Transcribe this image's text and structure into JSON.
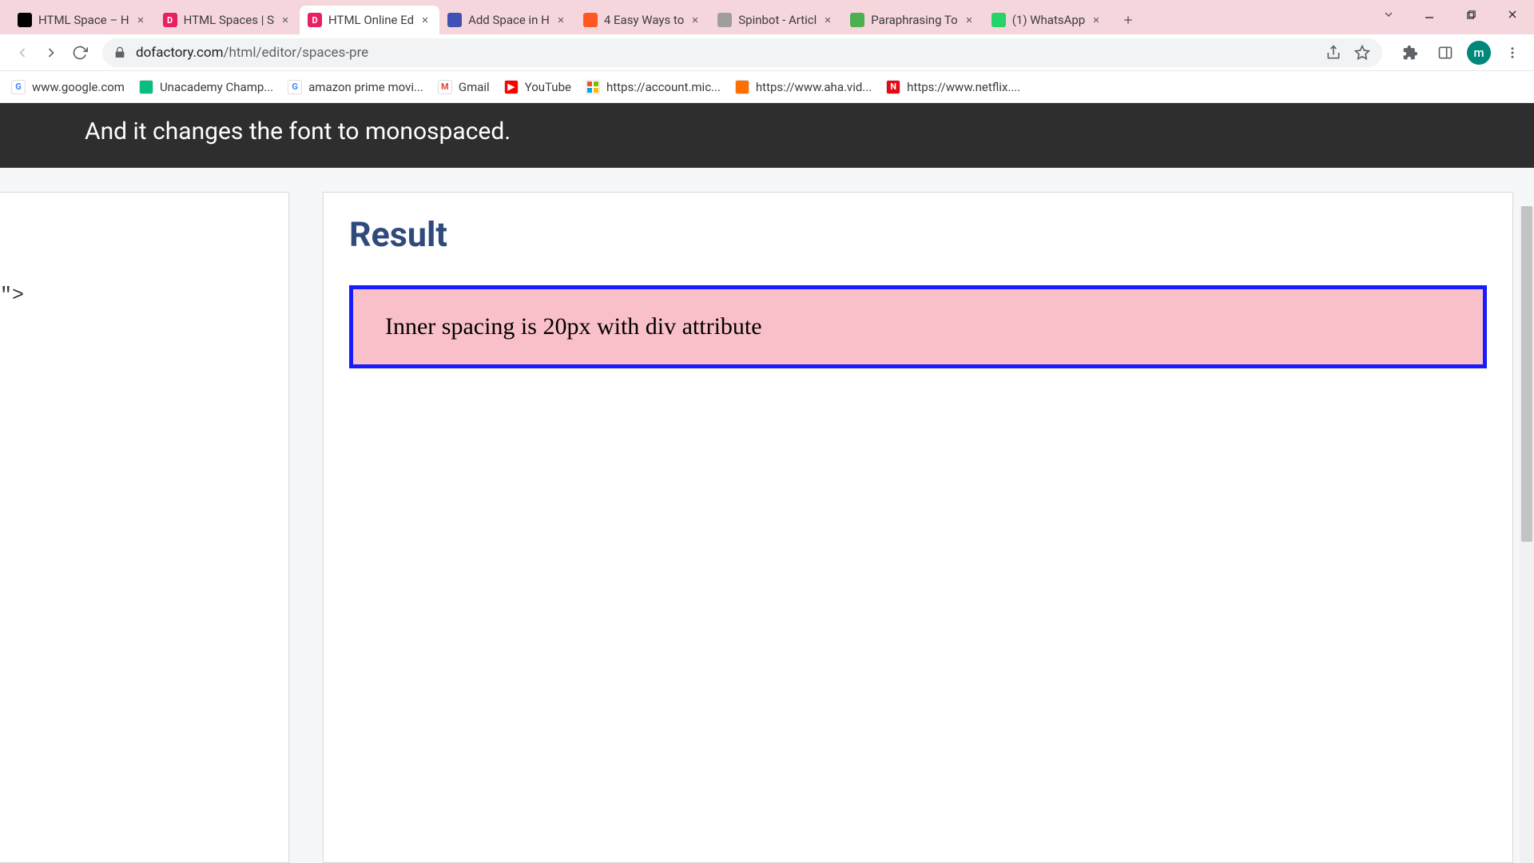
{
  "tabs": [
    {
      "title": "HTML Space – H",
      "favicon_bg": "#000",
      "favicon_letter": ""
    },
    {
      "title": "HTML Spaces | S",
      "favicon_bg": "#e91e63",
      "favicon_letter": "D"
    },
    {
      "title": "HTML Online Ed",
      "favicon_bg": "#e91e63",
      "favicon_letter": "D",
      "active": true
    },
    {
      "title": "Add Space in H",
      "favicon_bg": "#3f51b5",
      "favicon_letter": ""
    },
    {
      "title": "4 Easy Ways to",
      "favicon_bg": "#ff5722",
      "favicon_letter": ""
    },
    {
      "title": "Spinbot - Articl",
      "favicon_bg": "#9e9e9e",
      "favicon_letter": ""
    },
    {
      "title": "Paraphrasing To",
      "favicon_bg": "#4caf50",
      "favicon_letter": ""
    },
    {
      "title": "(1) WhatsApp",
      "favicon_bg": "#25d366",
      "favicon_letter": ""
    }
  ],
  "address": {
    "domain": "dofactory.com",
    "path": "/html/editor/spaces-pre"
  },
  "avatar_letter": "m",
  "bookmarks": [
    {
      "label": "www.google.com",
      "favicon_bg": "#fff",
      "letter": "G",
      "letter_color": "#4285f4"
    },
    {
      "label": "Unacademy Champ...",
      "favicon_bg": "#08bd80",
      "letter": "",
      "letter_color": "#fff"
    },
    {
      "label": "amazon prime movi...",
      "favicon_bg": "#fff",
      "letter": "G",
      "letter_color": "#4285f4"
    },
    {
      "label": "Gmail",
      "favicon_bg": "#fff",
      "letter": "M",
      "letter_color": "#ea4335"
    },
    {
      "label": "YouTube",
      "favicon_bg": "#ff0000",
      "letter": "▶",
      "letter_color": "#fff"
    },
    {
      "label": "https://account.mic...",
      "favicon_bg": "#fff",
      "letter": "",
      "letter_color": "#000"
    },
    {
      "label": "https://www.aha.vid...",
      "favicon_bg": "#ff6f00",
      "letter": "",
      "letter_color": "#fff"
    },
    {
      "label": "https://www.netflix....",
      "favicon_bg": "#e50914",
      "letter": "N",
      "letter_color": "#fff"
    }
  ],
  "banner_text": "And it changes the font to monospaced.",
  "code_fragment": "lue;\">",
  "result": {
    "heading": "Result",
    "demo_text": "Inner spacing is 20px with div attribute"
  }
}
